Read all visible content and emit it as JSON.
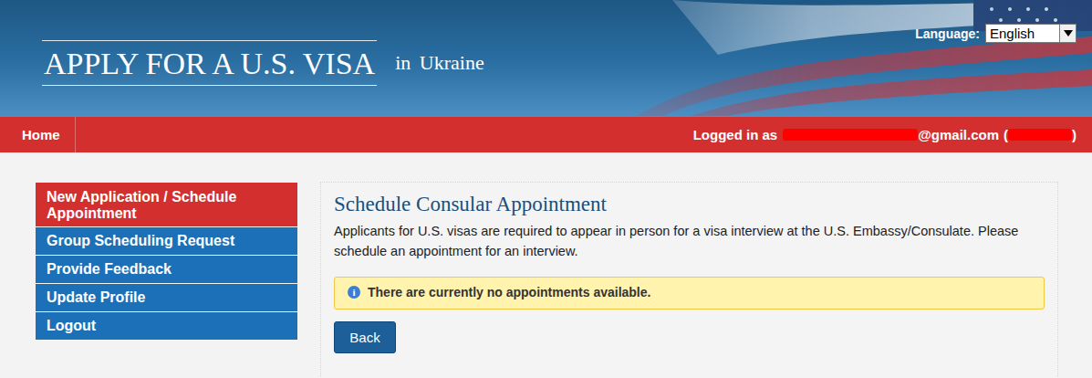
{
  "header": {
    "title": "APPLY FOR A U.S. VISA",
    "subtitle": "in Ukraine",
    "language_label": "Language:",
    "language_value": "English"
  },
  "nav": {
    "home": "Home",
    "user": {
      "prefix": "Logged in as",
      "email_suffix": "@gmail.com",
      "paren_open": "(",
      "paren_close": ")"
    }
  },
  "sidebar": {
    "items": [
      {
        "label": "New Application / Schedule Appointment",
        "selected": true
      },
      {
        "label": "Group Scheduling Request",
        "selected": false
      },
      {
        "label": "Provide Feedback",
        "selected": false
      },
      {
        "label": "Update Profile",
        "selected": false
      },
      {
        "label": "Logout",
        "selected": false
      }
    ]
  },
  "main": {
    "title": "Schedule Consular Appointment",
    "description": "Applicants for U.S. visas are required to appear in person for a visa interview at the U.S. Embassy/Consulate. Please schedule an appointment for an interview.",
    "alert": {
      "icon": "i",
      "text": "There are currently no appointments available."
    },
    "buttons": [
      "Back"
    ]
  }
}
